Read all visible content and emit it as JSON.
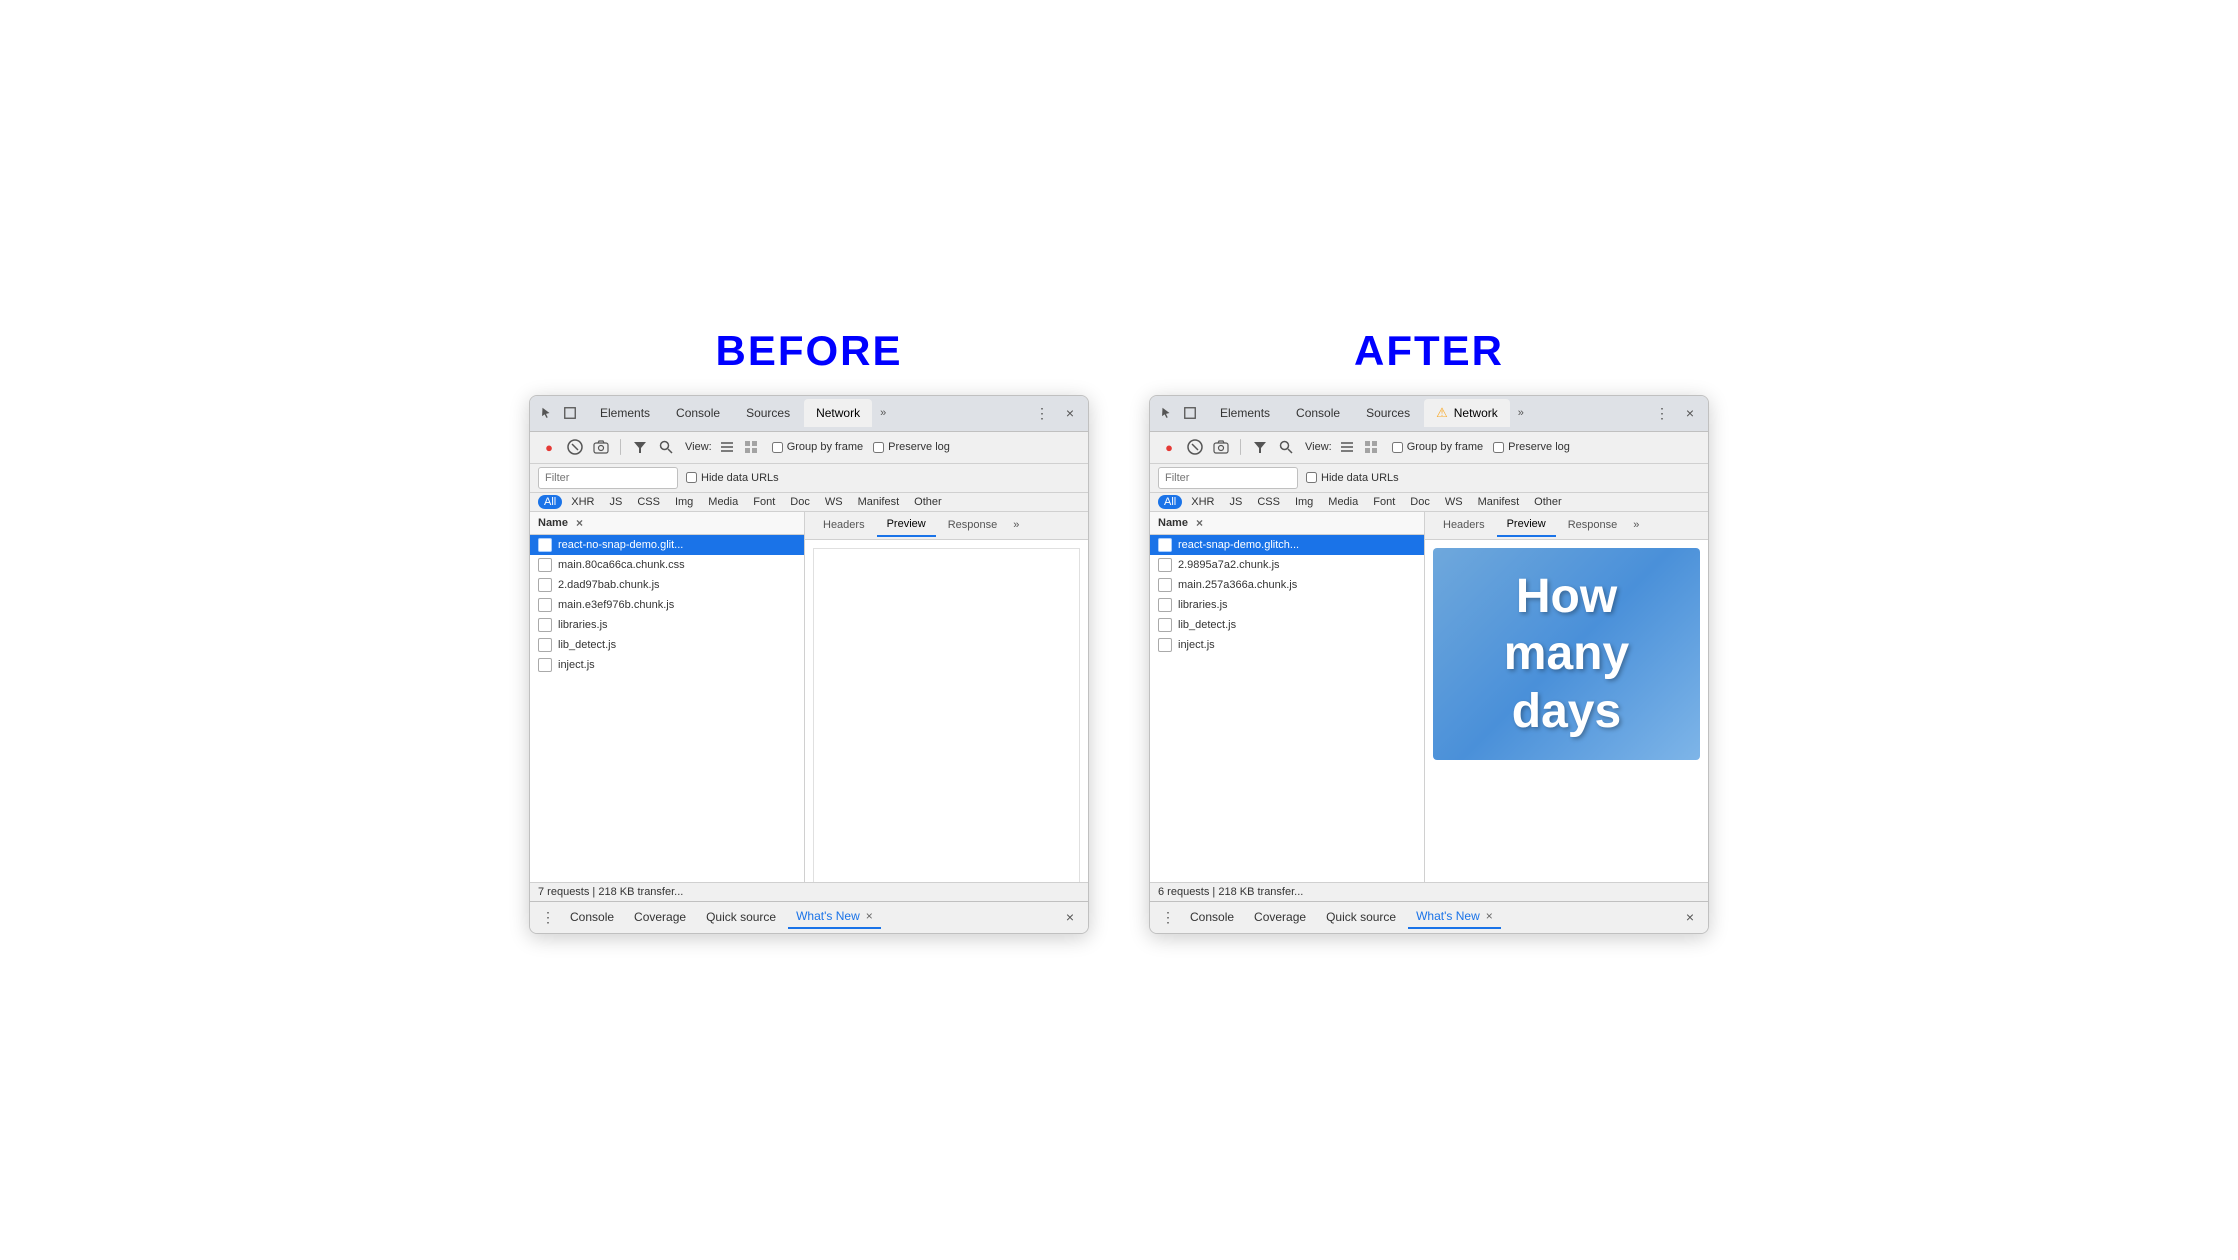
{
  "before": {
    "label": "BEFORE",
    "tabs": [
      "Elements",
      "Console",
      "Sources",
      "Network",
      "»"
    ],
    "active_tab": "Network",
    "toolbar": {
      "view_label": "View:",
      "group_by_frame": "Group by frame",
      "preserve_log": "Preserve log"
    },
    "filter": {
      "placeholder": "Filter",
      "hide_data_urls": "Hide data URLs"
    },
    "resource_types": [
      "All",
      "XHR",
      "JS",
      "CSS",
      "Img",
      "Media",
      "Font",
      "Doc",
      "WS",
      "Manifest",
      "Other"
    ],
    "active_resource": "All",
    "file_list_header": "Name",
    "files": [
      "react-no-snap-demo.glit...",
      "main.80ca66ca.chunk.css",
      "2.dad97bab.chunk.js",
      "main.e3ef976b.chunk.js",
      "libraries.js",
      "lib_detect.js",
      "inject.js"
    ],
    "selected_file": 0,
    "preview_tabs": [
      "Headers",
      "Preview",
      "Response",
      "»"
    ],
    "active_preview_tab": "Preview",
    "preview_type": "blank",
    "status": "7 requests | 218 KB transfer...",
    "drawer_tabs": [
      "Console",
      "Coverage",
      "Quick source",
      "What's New"
    ],
    "active_drawer_tab": "What's New"
  },
  "after": {
    "label": "AFTER",
    "tabs": [
      "Elements",
      "Console",
      "Sources",
      "Network",
      "»"
    ],
    "active_tab": "Network",
    "active_tab_warning": true,
    "toolbar": {
      "view_label": "View:",
      "group_by_frame": "Group by frame",
      "preserve_log": "Preserve log"
    },
    "filter": {
      "placeholder": "Filter",
      "hide_data_urls": "Hide data URLs"
    },
    "resource_types": [
      "All",
      "XHR",
      "JS",
      "CSS",
      "Img",
      "Media",
      "Font",
      "Doc",
      "WS",
      "Manifest",
      "Other"
    ],
    "active_resource": "All",
    "file_list_header": "Name",
    "files": [
      "react-snap-demo.glitch...",
      "2.9895a7a2.chunk.js",
      "main.257a366a.chunk.js",
      "libraries.js",
      "lib_detect.js",
      "inject.js"
    ],
    "selected_file": 0,
    "preview_tabs": [
      "Headers",
      "Preview",
      "Response",
      "»"
    ],
    "active_preview_tab": "Preview",
    "preview_type": "image",
    "preview_text": "How\nmany\ndays",
    "status": "6 requests | 218 KB transfer...",
    "drawer_tabs": [
      "Console",
      "Coverage",
      "Quick source",
      "What's New"
    ],
    "active_drawer_tab": "What's New"
  },
  "icons": {
    "cursor": "⬡",
    "box": "□",
    "record": "●",
    "stop": "⊘",
    "camera": "📷",
    "filter": "▽",
    "search": "🔍",
    "list1": "≡",
    "list2": "⋮⋮",
    "more": "»",
    "close": "×",
    "dots": "⋮",
    "warning": "⚠"
  }
}
